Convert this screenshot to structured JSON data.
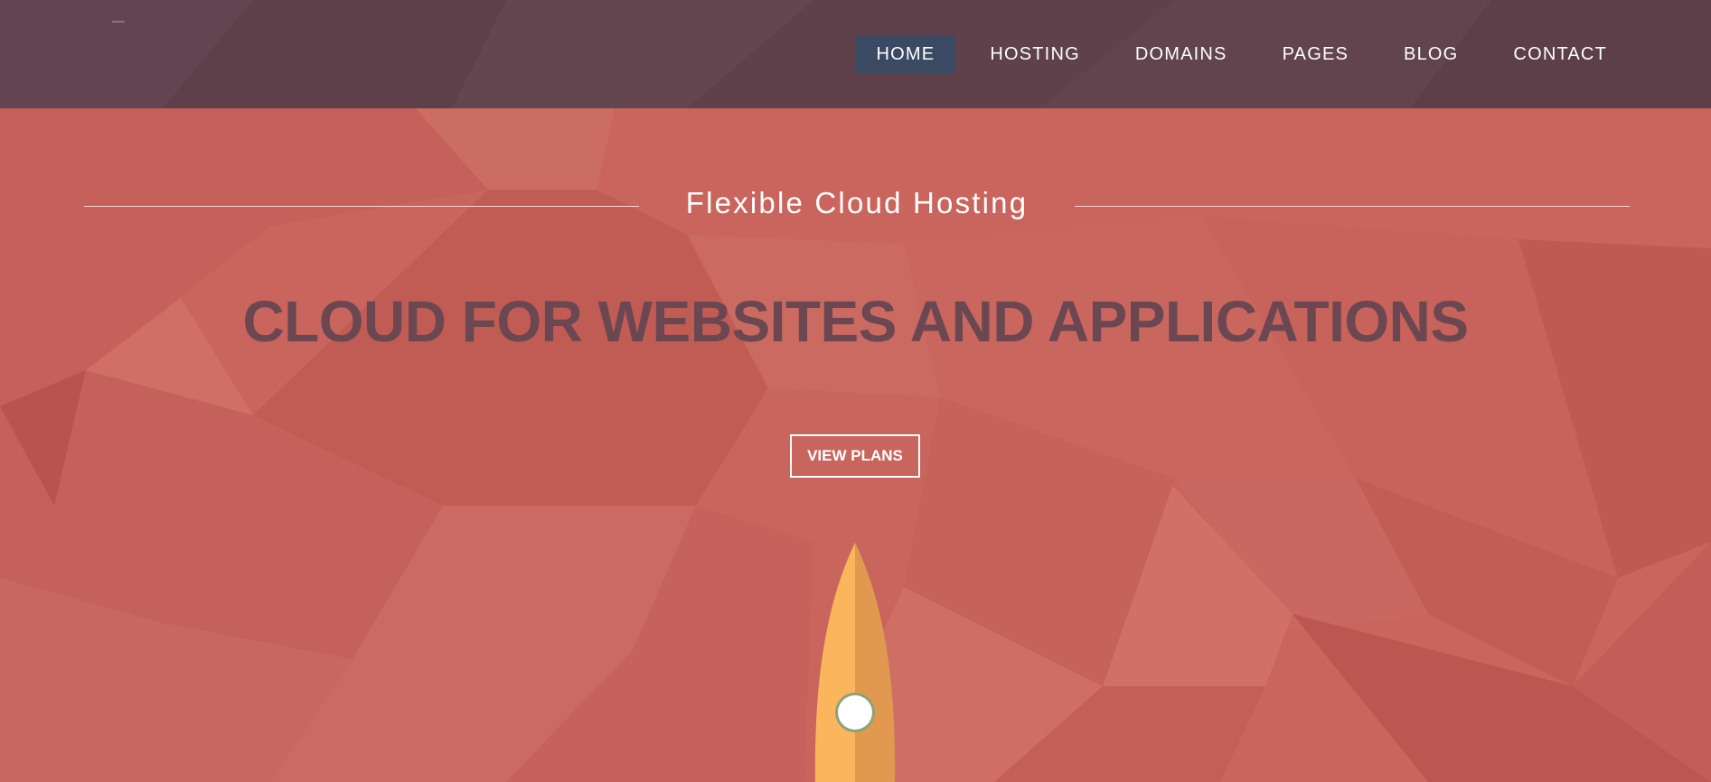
{
  "header": {
    "nav": [
      {
        "label": "HOME",
        "active": true
      },
      {
        "label": "HOSTING",
        "active": false
      },
      {
        "label": "DOMAINS",
        "active": false
      },
      {
        "label": "PAGES",
        "active": false
      },
      {
        "label": "BLOG",
        "active": false
      },
      {
        "label": "CONTACT",
        "active": false
      }
    ]
  },
  "hero": {
    "subtitle": "Flexible Cloud Hosting",
    "headline": "CLOUD FOR WEBSITES AND APPLICATIONS",
    "cta_label": "VIEW PLANS"
  },
  "icons": {
    "hero_illustration": "rocket-icon"
  },
  "colors": {
    "header_background": "#5f424c",
    "hero_background": "#c9655c",
    "nav_active": "#3a4a63",
    "headline_text": "#6a4751",
    "rocket_body": "#fbb55c",
    "rocket_shade": "#e0994f",
    "window": "#ffffff"
  }
}
